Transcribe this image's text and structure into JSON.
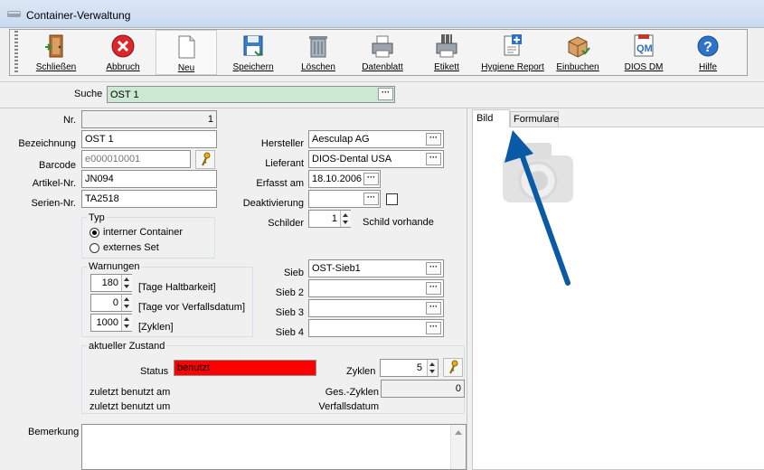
{
  "window": {
    "title": "Container-Verwaltung"
  },
  "toolbar": {
    "close": "Schließen",
    "cancel": "Abbruch",
    "new": "Neu",
    "save": "Speichern",
    "delete": "Löschen",
    "datasheet": "Datenblatt",
    "label": "Etikett",
    "hygiene": "Hygiene Report",
    "book_in": "Einbuchen",
    "dios": "DIOS DM",
    "help": "Hilfe"
  },
  "search": {
    "label": "Suche",
    "value": "OST 1"
  },
  "form": {
    "nr_label": "Nr.",
    "nr_value": "1",
    "bezeichnung_label": "Bezeichnung",
    "bezeichnung_value": "OST 1",
    "barcode_label": "Barcode",
    "barcode_value": "e000010001",
    "artikel_label": "Artikel-Nr.",
    "artikel_value": "JN094",
    "serien_label": "Serien-Nr.",
    "serien_value": "TA2518",
    "hersteller_label": "Hersteller",
    "hersteller_value": "Aesculap AG",
    "lieferant_label": "Lieferant",
    "lieferant_value": "DIOS-Dental USA",
    "erfasst_label": "Erfasst am",
    "erfasst_value": "18.10.2006",
    "deaktivierung_label": "Deaktivierung",
    "deaktivierung_value": "",
    "schilder_label": "Schilder",
    "schilder_value": "1",
    "schild_text": "Schild vorhande"
  },
  "typ": {
    "title": "Typ",
    "option1": "interner Container",
    "option2": "externes Set"
  },
  "warnungen": {
    "title": "Warnungen",
    "v1": "180",
    "l1": "[Tage Haltbarkeit]",
    "v2": "0",
    "l2": "[Tage vor Verfallsdatum]",
    "v3": "1000",
    "l3": "[Zyklen]"
  },
  "sieb": {
    "sieb_label": "Sieb",
    "sieb_value": "OST-Sieb1",
    "sieb2_label": "Sieb 2",
    "sieb3_label": "Sieb 3",
    "sieb4_label": "Sieb 4"
  },
  "zustand": {
    "title": "aktueller Zustand",
    "status_label": "Status",
    "status_value": "benutzt",
    "status_color": "#ff0000",
    "zyklen_label": "Zyklen",
    "zyklen_value": "5",
    "ges_label": "Ges.-Zyklen",
    "ges_value": "0",
    "benutzt_am": "zuletzt benutzt am",
    "benutzt_um": "zuletzt benutzt um",
    "verfall": "Verfallsdatum"
  },
  "bemerkung": {
    "label": "Bemerkung"
  },
  "tabs": {
    "bild": "Bild",
    "formulare": "Formulare"
  },
  "colors": {
    "search_bg": "#cde8d2",
    "arrow": "#0b5aa6"
  }
}
